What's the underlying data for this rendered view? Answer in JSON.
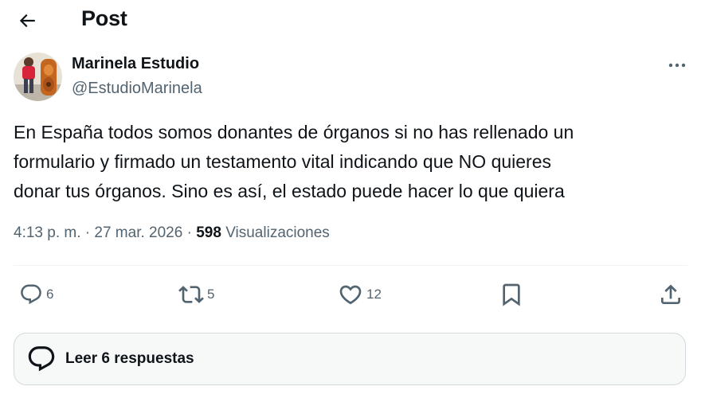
{
  "header": {
    "back_icon": "arrow-left-icon",
    "title": "Post"
  },
  "author": {
    "display_name": "Marinela Estudio",
    "handle": "@EstudioMarinela",
    "more_icon": "more-horizontal-icon"
  },
  "post": {
    "lines": [
      "En España todos somos donantes de órganos si no has rellenado un",
      "formulario y firmado un testamento vital indicando que NO quieres",
      "donar tus órganos. Sino es así, el estado puede hacer lo que quiera"
    ],
    "time": "4:13 p. m.",
    "separator": "·",
    "date": "27 mar. 2026",
    "views_count": "598",
    "views_label": "Visualizaciones"
  },
  "actions": {
    "replies": {
      "icon": "reply-icon",
      "count": "6"
    },
    "reposts": {
      "icon": "repost-icon",
      "count": "5"
    },
    "likes": {
      "icon": "heart-icon",
      "count": "12"
    },
    "bookmark": {
      "icon": "bookmark-icon"
    },
    "share": {
      "icon": "share-icon"
    }
  },
  "read_replies": {
    "icon": "reply-icon",
    "label": "Leer 6 respuestas"
  },
  "colors": {
    "primary_text": "#0f1419",
    "secondary_text": "#536471",
    "divider": "#eff3f4",
    "button_border": "#cfd9de",
    "button_background": "#f7f9f9"
  }
}
